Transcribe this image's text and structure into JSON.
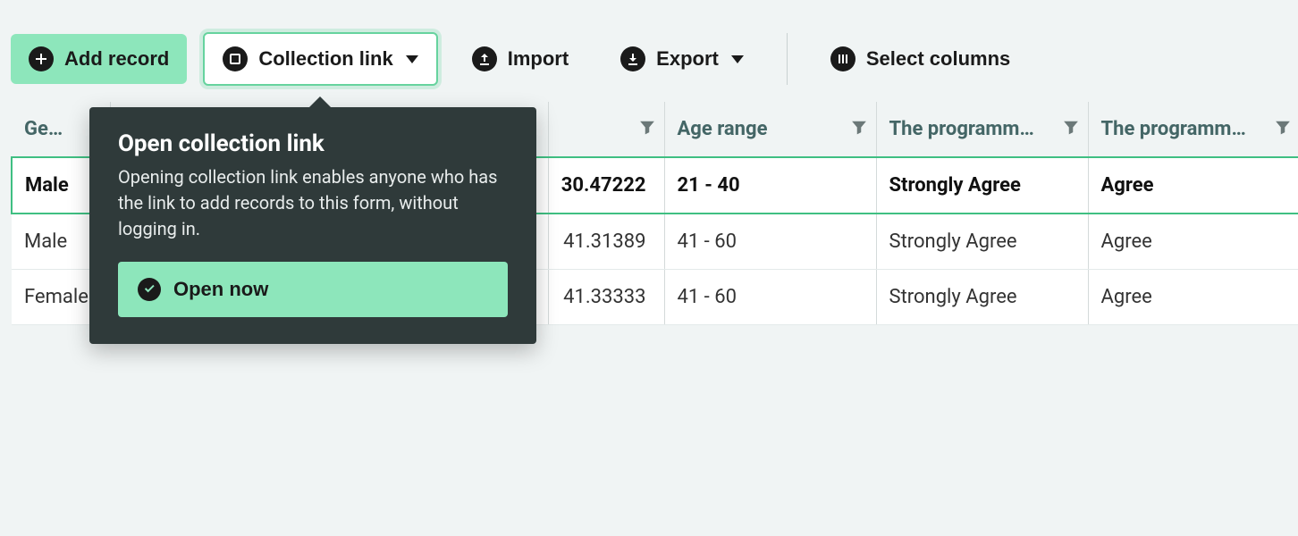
{
  "toolbar": {
    "add_record": "Add record",
    "collection_link": "Collection link",
    "import": "Import",
    "export": "Export",
    "select_columns": "Select columns"
  },
  "popover": {
    "title": "Open collection link",
    "body": "Opening collection link enables anyone who has the link to add records to this form, without logging in.",
    "open_now": "Open now"
  },
  "columns": [
    {
      "label": "Gender"
    },
    {
      "label": ""
    },
    {
      "label": ""
    },
    {
      "label": "Age range"
    },
    {
      "label": "The programm…"
    },
    {
      "label": "The programm…"
    }
  ],
  "rows": [
    {
      "selected": true,
      "gender": "Male",
      "num": "30.47222",
      "age": "21 - 40",
      "p1": "Strongly Agree",
      "p2": "Agree"
    },
    {
      "selected": false,
      "gender": "Male",
      "num": "41.31389",
      "age": "41 - 60",
      "p1": "Strongly Agree",
      "p2": "Agree"
    },
    {
      "selected": false,
      "gender": "Female",
      "num": "41.33333",
      "age": "41 - 60",
      "p1": "Strongly Agree",
      "p2": "Agree"
    }
  ]
}
